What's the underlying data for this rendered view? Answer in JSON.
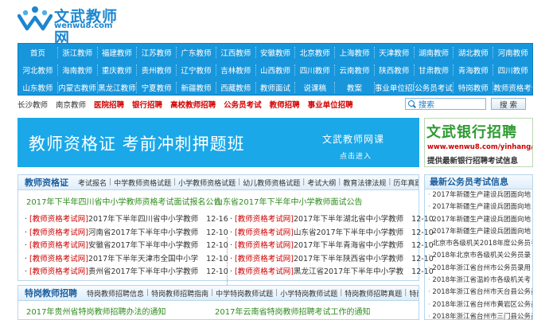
{
  "logo": {
    "main": "文武教师网",
    "sub": "wenwu8.com"
  },
  "nav": {
    "row1": [
      "首页",
      "浙江教师",
      "福建教师",
      "江苏教师",
      "广东教师",
      "江西教师",
      "安徽教师",
      "北京教师",
      "上海教师",
      "天津教师",
      "湖南教师",
      "湖北教师",
      "河南教师"
    ],
    "row2": [
      "河北教师",
      "海南教师",
      "重庆教师",
      "贵州教师",
      "辽宁教师",
      "吉林教师",
      "山西教师",
      "四川教师",
      "云南教师",
      "陕西教师",
      "甘肃教师",
      "青海教师",
      "四川教师"
    ],
    "row3": [
      "山东教师",
      "内蒙古教师",
      "黑龙江教师",
      "宁夏教师",
      "新疆教师",
      "西藏教师",
      "教师面试",
      "说课稿",
      "教案",
      "事业单位招聘",
      "公务员考试",
      "特岗教师",
      "教师资格考试"
    ]
  },
  "quick_links": [
    {
      "label": "长沙教师",
      "red": false
    },
    {
      "label": "南京教师",
      "red": false
    },
    {
      "label": "医院招聘",
      "red": true
    },
    {
      "label": "银行招聘",
      "red": true
    },
    {
      "label": "高校教师招聘",
      "red": true
    },
    {
      "label": "公务员考试",
      "red": true
    },
    {
      "label": "教师招聘",
      "red": true
    },
    {
      "label": "事业单位招聘",
      "red": true
    }
  ],
  "search": {
    "placeholder": "搜索",
    "button": "搜 索"
  },
  "banner": {
    "title": "教师资格证 考前冲刺押题班",
    "right": "文武教师网课",
    "sub": "点击进入"
  },
  "ad": {
    "title": "文武银行招聘",
    "url": "www.wenwu8.com/yinhang/",
    "sub": "提供最新银行招聘考试信息"
  },
  "panel1": {
    "title": "教师资格证",
    "links": [
      "考试报名",
      "中学教师资格试题",
      "小学教师资格试题",
      "幼儿教师资格试题",
      "考试大纲",
      "教育法律法规",
      "历年真题"
    ],
    "headlines": [
      "2017年下半年四川省中小学教师资格考试面试报名公告",
      "山东省2017年下半年中小学教师面试公告"
    ],
    "left": [
      {
        "tag": "[教师资格考试网]",
        "text": "2017年下半年四川省中小学教师",
        "date": "12-16"
      },
      {
        "tag": "[教师资格考试网]",
        "text": "河南省2017年下半年中小学教师",
        "date": "12-10"
      },
      {
        "tag": "[教师资格考试网]",
        "text": "安徽省2017年下半年中小学教师",
        "date": "12-10"
      },
      {
        "tag": "[教师资格考试网]",
        "text": "2017年下半年天津市全国中小学",
        "date": "12-10"
      },
      {
        "tag": "[教师资格考试网]",
        "text": "贵州省2017年下半年中小学教师",
        "date": "12-10"
      }
    ],
    "right": [
      {
        "tag": "[教师资格考试网]",
        "text": "2017年下半年湖北省中小学教师",
        "date": "12-10"
      },
      {
        "tag": "[教师资格考试网]",
        "text": "山东省2017年下半年中小学教师",
        "date": "12-10"
      },
      {
        "tag": "[教师资格考试网]",
        "text": "2017年下半年青海省中小学教师",
        "date": "12-10"
      },
      {
        "tag": "[教师资格考试网]",
        "text": "2017年下半年陕西省中小学教师",
        "date": "12-10"
      },
      {
        "tag": "[教师资格考试网]",
        "text": "黑龙江省2017年下半年中小学教",
        "date": "12-10"
      }
    ]
  },
  "panel2": {
    "title": "特岗教师招聘",
    "links": [
      "特岗教师招聘信息",
      "特岗教师招聘指南",
      "中学特岗教师试题",
      "小学特岗教师试题",
      "特岗教师招聘真题",
      "特岗教师面试"
    ],
    "headlines": [
      "2017年贵州省特岗教师招聘办法的通知",
      "2017年云南省特岗教师招聘考试工作的通知"
    ]
  },
  "side": {
    "title": "最新公务员考试信息",
    "items": [
      "2017年新疆生产建设兵团面向地",
      "2017年新疆生产建设兵团面向地",
      "2017年新疆生产建设兵团面向地",
      "2017年新疆生产建设兵团面向地",
      "北京市各级机关2018年度公务员考",
      "2018年北京市各级机关公务员录",
      "2018年浙江省台州市公务员录用",
      "2018年浙江省温岭市各级机关考",
      "2018年浙江省台州市天台县公务员",
      "2018年浙江省台州市黄岩区公务员",
      "2018年浙江省台州市三门县公务员",
      "2018年浙江省临海市公务员考"
    ]
  }
}
